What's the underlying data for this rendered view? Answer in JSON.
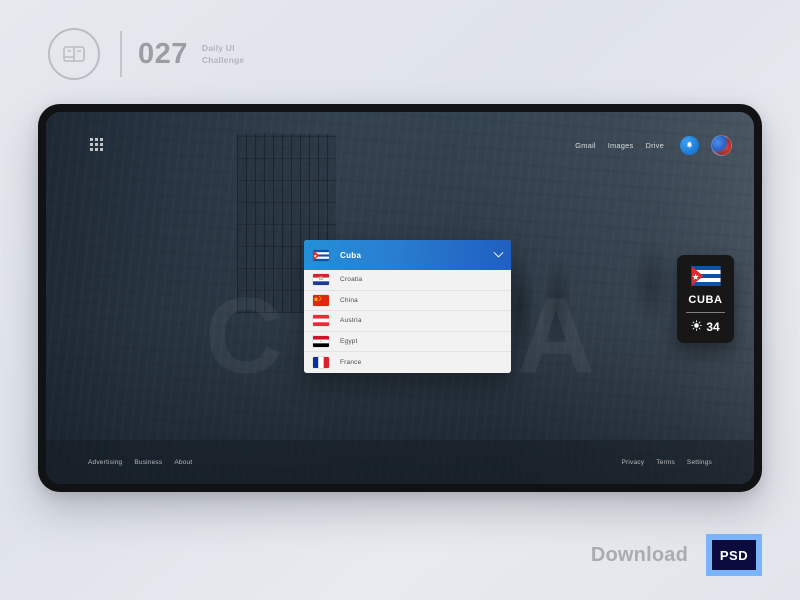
{
  "brand": {
    "logo_icon": "dailyui-circle-logo",
    "number": "027",
    "sub_line1": "Daily UI",
    "sub_line2": "Challenge"
  },
  "screen": {
    "apps_icon": "apps-grid-icon",
    "topnav": {
      "links": [
        "Gmail",
        "Images",
        "Drive"
      ],
      "notification_icon": "notification-bell-icon",
      "avatar_icon": "user-avatar"
    },
    "watermark": "CUBA",
    "dropdown": {
      "selected": {
        "label": "Cuba",
        "flag": "flag-cuba"
      },
      "chevron_icon": "chevron-down-icon",
      "options": [
        {
          "label": "Croatia",
          "flag": "flag-croatia"
        },
        {
          "label": "China",
          "flag": "flag-china"
        },
        {
          "label": "Austria",
          "flag": "flag-austria"
        },
        {
          "label": "Egypt",
          "flag": "flag-egypt"
        },
        {
          "label": "France",
          "flag": "flag-france"
        }
      ]
    },
    "weather_card": {
      "flag": "flag-cuba",
      "country": "CUBA",
      "condition_icon": "sun-icon",
      "temperature": "34"
    },
    "footer": {
      "left_links": [
        "Advertising",
        "Business",
        "About"
      ],
      "right_links": [
        "Privacy",
        "Terms",
        "Settings"
      ]
    }
  },
  "download": {
    "label": "Download",
    "badge": "PSD"
  },
  "colors": {
    "accent_blue": "#2a7fd0",
    "badge_border": "#7ab4fb",
    "badge_fill": "#0b0b3d",
    "card_dark": "#171717",
    "page_bg": "#e3e6ec"
  }
}
